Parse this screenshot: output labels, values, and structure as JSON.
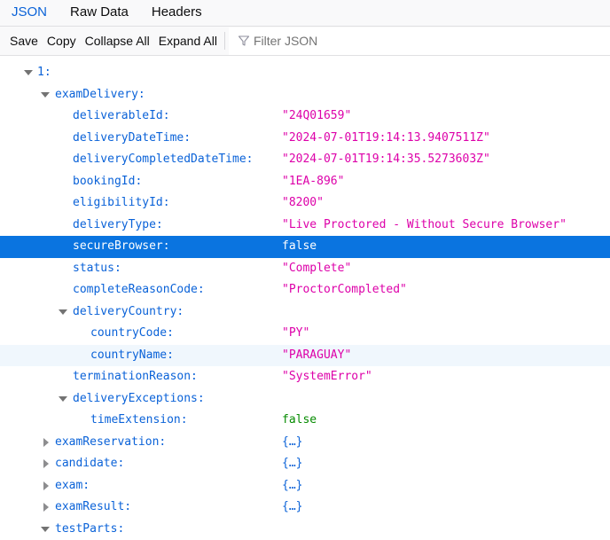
{
  "tabs": [
    {
      "label": "JSON",
      "active": true
    },
    {
      "label": "Raw Data",
      "active": false
    },
    {
      "label": "Headers",
      "active": false
    }
  ],
  "toolbar": {
    "save_label": "Save",
    "copy_label": "Copy",
    "collapse_all_label": "Collapse All",
    "expand_all_label": "Expand All",
    "filter_placeholder": "Filter JSON",
    "filter_value": ""
  },
  "tree": {
    "item_index": "1:",
    "examDelivery": {
      "key": "examDelivery:",
      "deliverableId": {
        "key": "deliverableId:",
        "value": "\"24Q01659\""
      },
      "deliveryDateTime": {
        "key": "deliveryDateTime:",
        "value": "\"2024-07-01T19:14:13.9407511Z\""
      },
      "deliveryCompletedDateTime": {
        "key": "deliveryCompletedDateTime:",
        "value": "\"2024-07-01T19:14:35.5273603Z\""
      },
      "bookingId": {
        "key": "bookingId:",
        "value": "\"1EA-896\""
      },
      "eligibilityId": {
        "key": "eligibilityId:",
        "value": "\"8200\""
      },
      "deliveryType": {
        "key": "deliveryType:",
        "value": "\"Live Proctored - Without Secure Browser\""
      },
      "secureBrowser": {
        "key": "secureBrowser:",
        "value": "false"
      },
      "status": {
        "key": "status:",
        "value": "\"Complete\""
      },
      "completeReasonCode": {
        "key": "completeReasonCode:",
        "value": "\"ProctorCompleted\""
      },
      "deliveryCountry": {
        "key": "deliveryCountry:",
        "countryCode": {
          "key": "countryCode:",
          "value": "\"PY\""
        },
        "countryName": {
          "key": "countryName:",
          "value": "\"PARAGUAY\""
        }
      },
      "terminationReason": {
        "key": "terminationReason:",
        "value": "\"SystemError\""
      },
      "deliveryExceptions": {
        "key": "deliveryExceptions:",
        "timeExtension": {
          "key": "timeExtension:",
          "value": "false"
        }
      }
    },
    "examReservation": {
      "key": "examReservation:",
      "value": "{…}"
    },
    "candidate": {
      "key": "candidate:",
      "value": "{…}"
    },
    "exam": {
      "key": "exam:",
      "value": "{…}"
    },
    "examResult": {
      "key": "examResult:",
      "value": "{…}"
    },
    "testParts": {
      "key": "testParts:"
    }
  },
  "colors": {
    "accent": "#0a62d8",
    "selected_row": "#0a74e0",
    "string": "#dd00a9",
    "boolean": "#058b00"
  }
}
